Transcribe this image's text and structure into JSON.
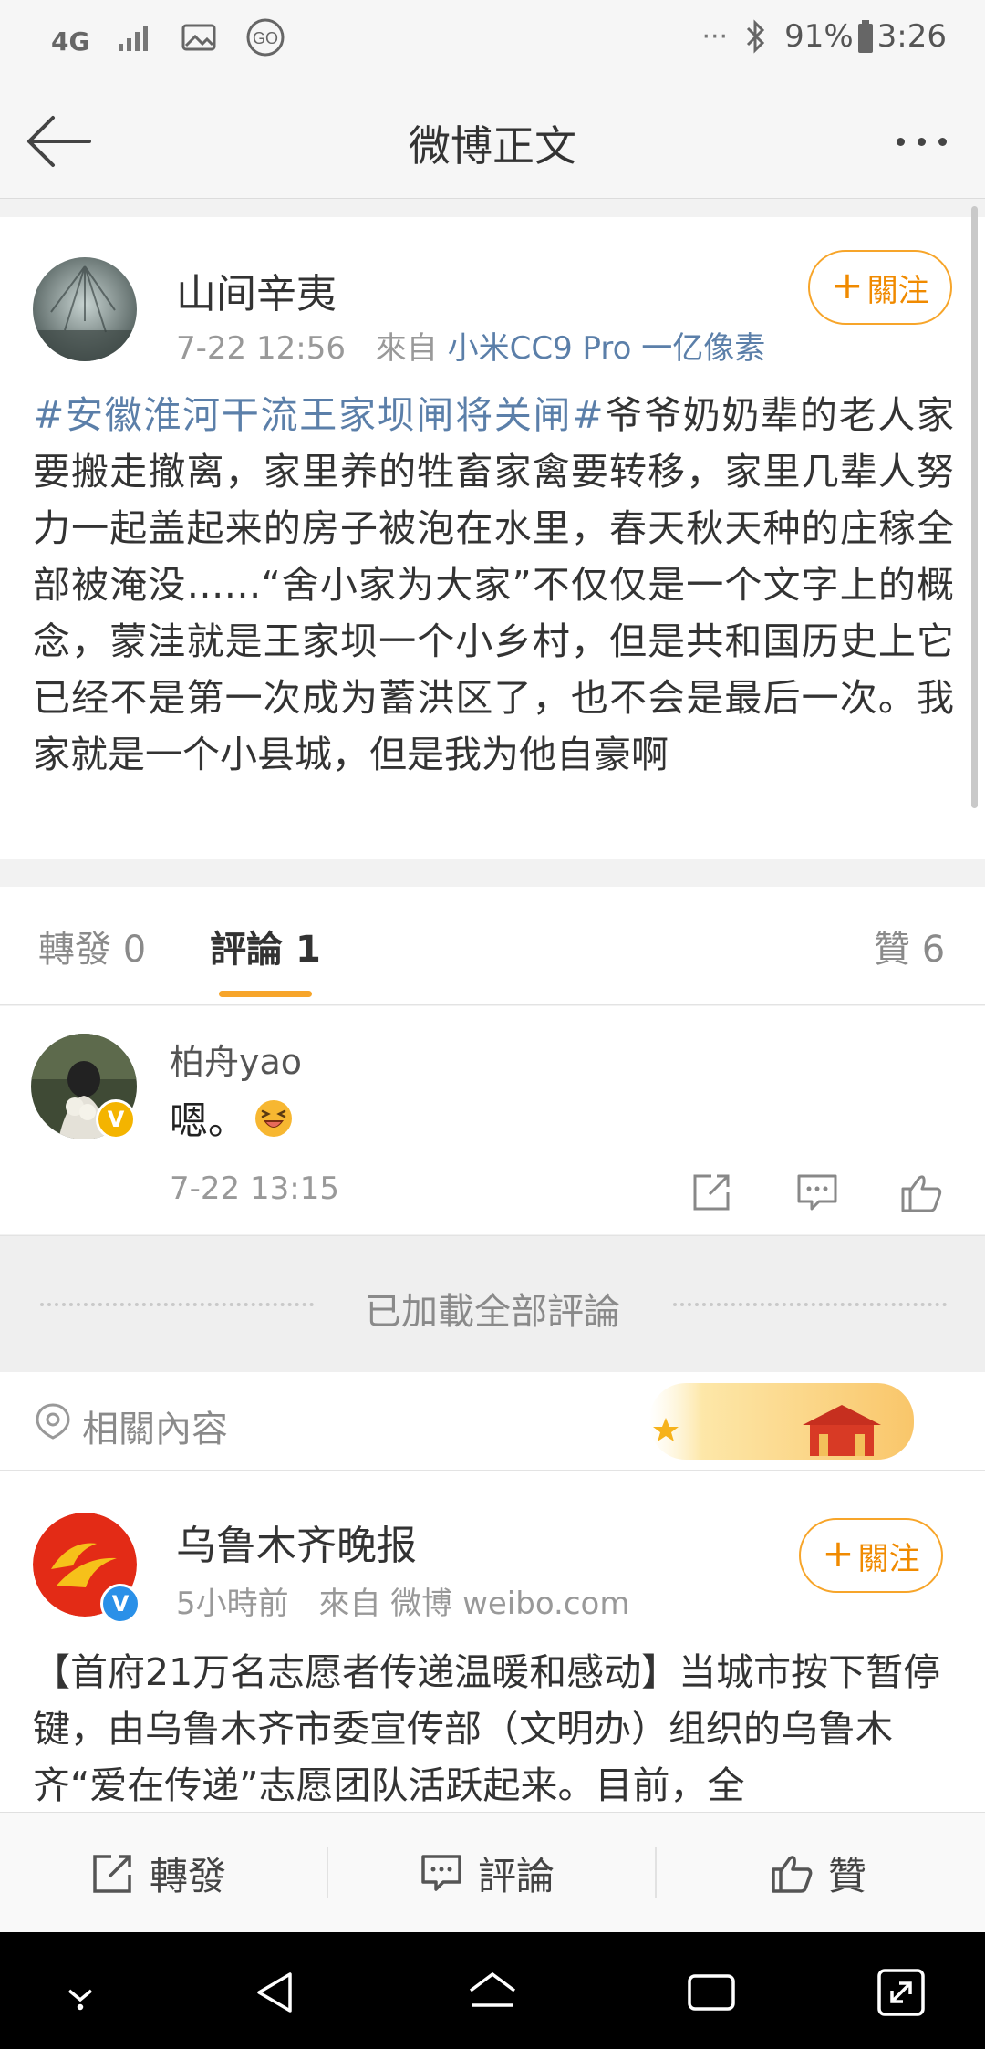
{
  "status_bar": {
    "network": "4G",
    "battery": "91%",
    "time": "3:26",
    "dots": "···"
  },
  "nav": {
    "title": "微博正文"
  },
  "post": {
    "username": "山间辛夷",
    "time": "7-22 12:56",
    "source_prefix": "來自",
    "source": "小米CC9 Pro 一亿像素",
    "follow_label": "關注",
    "hashtag": "#安徽淮河干流王家坝闸将关闸#",
    "text": "爷爷奶奶辈的老人家要搬走撤离，家里养的牲畜家禽要转移，家里几辈人努力一起盖起来的房子被泡在水里，春天秋天种的庄稼全部被淹没……“舍小家为大家”不仅仅是一个文字上的概念，蒙洼就是王家坝一个小乡村，但是共和国历史上它已经不是第一次成为蓄洪区了，也不会是最后一次。我家就是一个小县城，但是我为他自豪啊"
  },
  "tabs": {
    "repost_label": "轉發",
    "repost_count": "0",
    "comment_label": "評論",
    "comment_count": "1",
    "like_label": "贊",
    "like_count": "6"
  },
  "comment": {
    "username": "柏舟yao",
    "text": "嗯。",
    "time": "7-22 13:15",
    "badge": "V"
  },
  "all_loaded": "已加載全部評論",
  "related": {
    "label": "相關內容"
  },
  "post2": {
    "username": "乌鲁木齐晚报",
    "time": "5小時前",
    "source_prefix": "來自",
    "source": "微博 weibo.com",
    "follow_label": "關注",
    "badge": "V",
    "text": "【首府21万名志愿者传递温暖和感动】当城市按下暂停键，由乌鲁木齐市委宣传部（文明办）组织的乌鲁木齐“爱在传递”志愿团队活跃起来。目前，全"
  },
  "action_bar": {
    "repost": "轉發",
    "comment": "評論",
    "like": "贊"
  },
  "colors": {
    "accent_orange": "#f7a52a",
    "link_blue": "#5b7fa9"
  }
}
